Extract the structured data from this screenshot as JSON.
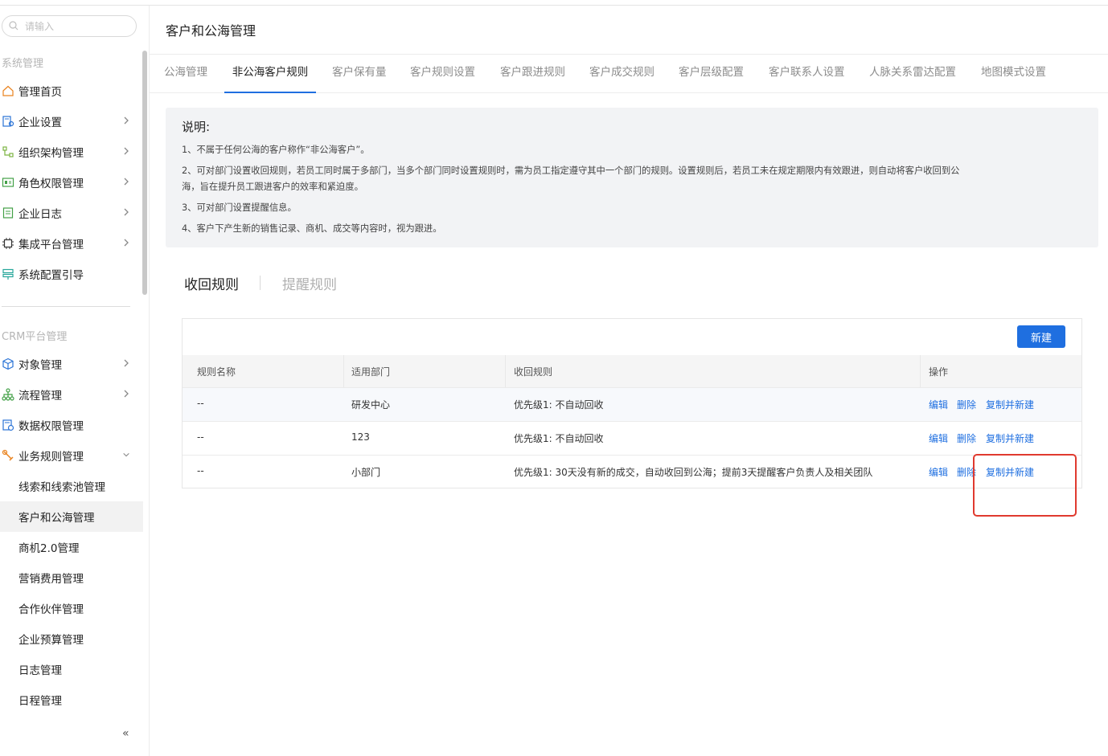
{
  "sidebar": {
    "search_placeholder": "请输入",
    "section1_title": "系统管理",
    "section1_items": [
      {
        "label": "管理首页",
        "icon": "home-icon"
      },
      {
        "label": "企业设置",
        "icon": "enterprise-settings-icon"
      },
      {
        "label": "组织架构管理",
        "icon": "org-chart-icon"
      },
      {
        "label": "角色权限管理",
        "icon": "role-card-icon"
      },
      {
        "label": "企业日志",
        "icon": "log-document-icon"
      },
      {
        "label": "集成平台管理",
        "icon": "chip-icon"
      },
      {
        "label": "系统配置引导",
        "icon": "signpost-icon"
      }
    ],
    "section2_title": "CRM平台管理",
    "section2_items": [
      {
        "label": "对象管理",
        "icon": "cube-icon"
      },
      {
        "label": "流程管理",
        "icon": "flow-tree-icon"
      },
      {
        "label": "数据权限管理",
        "icon": "data-permission-icon"
      },
      {
        "label": "业务规则管理",
        "icon": "tools-icon"
      }
    ],
    "sub_items": [
      "线索和线索池管理",
      "客户和公海管理",
      "商机2.0管理",
      "营销费用管理",
      "合作伙伴管理",
      "企业预算管理",
      "日志管理",
      "日程管理"
    ],
    "collapse_glyph": "«"
  },
  "page": {
    "title": "客户和公海管理",
    "tabs": [
      "公海管理",
      "非公海客户规则",
      "客户保有量",
      "客户规则设置",
      "客户跟进规则",
      "客户成交规则",
      "客户层级配置",
      "客户联系人设置",
      "人脉关系雷达配置",
      "地图模式设置"
    ],
    "active_tab": "非公海客户规则"
  },
  "notice": {
    "title": "说明:",
    "lines": [
      "1、不属于任何公海的客户称作“非公海客户”。",
      "2、可对部门设置收回规则，若员工同时属于多部门，当多个部门同时设置规则时，需为员工指定遵守其中一个部门的规则。设置规则后，若员工未在规定期限内有效跟进，则自动将客户收回到公",
      "海，旨在提升员工跟进客户的效率和紧迫度。",
      "3、可对部门设置提醒信息。",
      "4、客户下产生新的销售记录、商机、成交等内容时，视为跟进。"
    ]
  },
  "rule_tabs": {
    "active": "收回规则",
    "inactive": "提醒规则"
  },
  "table": {
    "new_button": "新建",
    "headers": [
      "规则名称",
      "适用部门",
      "收回规则",
      "操作"
    ],
    "rows": [
      {
        "name": "--",
        "dept": "研发中心",
        "rule": "优先级1:   不自动回收"
      },
      {
        "name": "--",
        "dept": "123",
        "rule": "优先级1:   不自动回收"
      },
      {
        "name": "--",
        "dept": "小部门",
        "rule": "优先级1:   30天没有新的成交，自动收回到公海；提前3天提醒客户负责人及相关团队"
      }
    ],
    "actions": {
      "edit": "编辑",
      "delete": "删除",
      "copy_new": "复制并新建"
    }
  },
  "colors": {
    "accent": "#1f6fe0",
    "highlight_box": "#e03a2f"
  }
}
